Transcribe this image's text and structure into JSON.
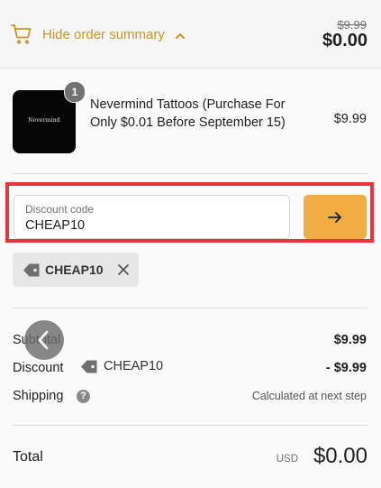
{
  "header": {
    "toggle_label": "Hide order summary",
    "original_price": "$9.99",
    "total": "$0.00",
    "icons": {
      "cart": "cart-icon",
      "chevron": "chevron-up-icon"
    }
  },
  "product": {
    "name": "Nevermind Tattoos (Purchase For Only $0.01 Before September 15)",
    "quantity": "1",
    "price": "$9.99",
    "image_logo_text": "Nevermind"
  },
  "discount": {
    "field_label": "Discount code",
    "field_value": "CHEAP10",
    "applied_code": "CHEAP10",
    "icons": {
      "apply": "arrow-right-icon",
      "tag": "tag-icon",
      "remove": "close-icon"
    }
  },
  "summary": {
    "subtotal_label": "Subtotal",
    "subtotal_value": "$9.99",
    "discount_label": "Discount",
    "discount_code": "CHEAP10",
    "discount_value": "- $9.99",
    "shipping_label": "Shipping",
    "shipping_help": "?",
    "shipping_value": "Calculated at next step",
    "total_label": "Total",
    "currency": "USD",
    "total_value": "$0.00"
  },
  "colors": {
    "accent": "#c9952b",
    "button": "#f1ac44",
    "highlight": "#e8343b"
  }
}
